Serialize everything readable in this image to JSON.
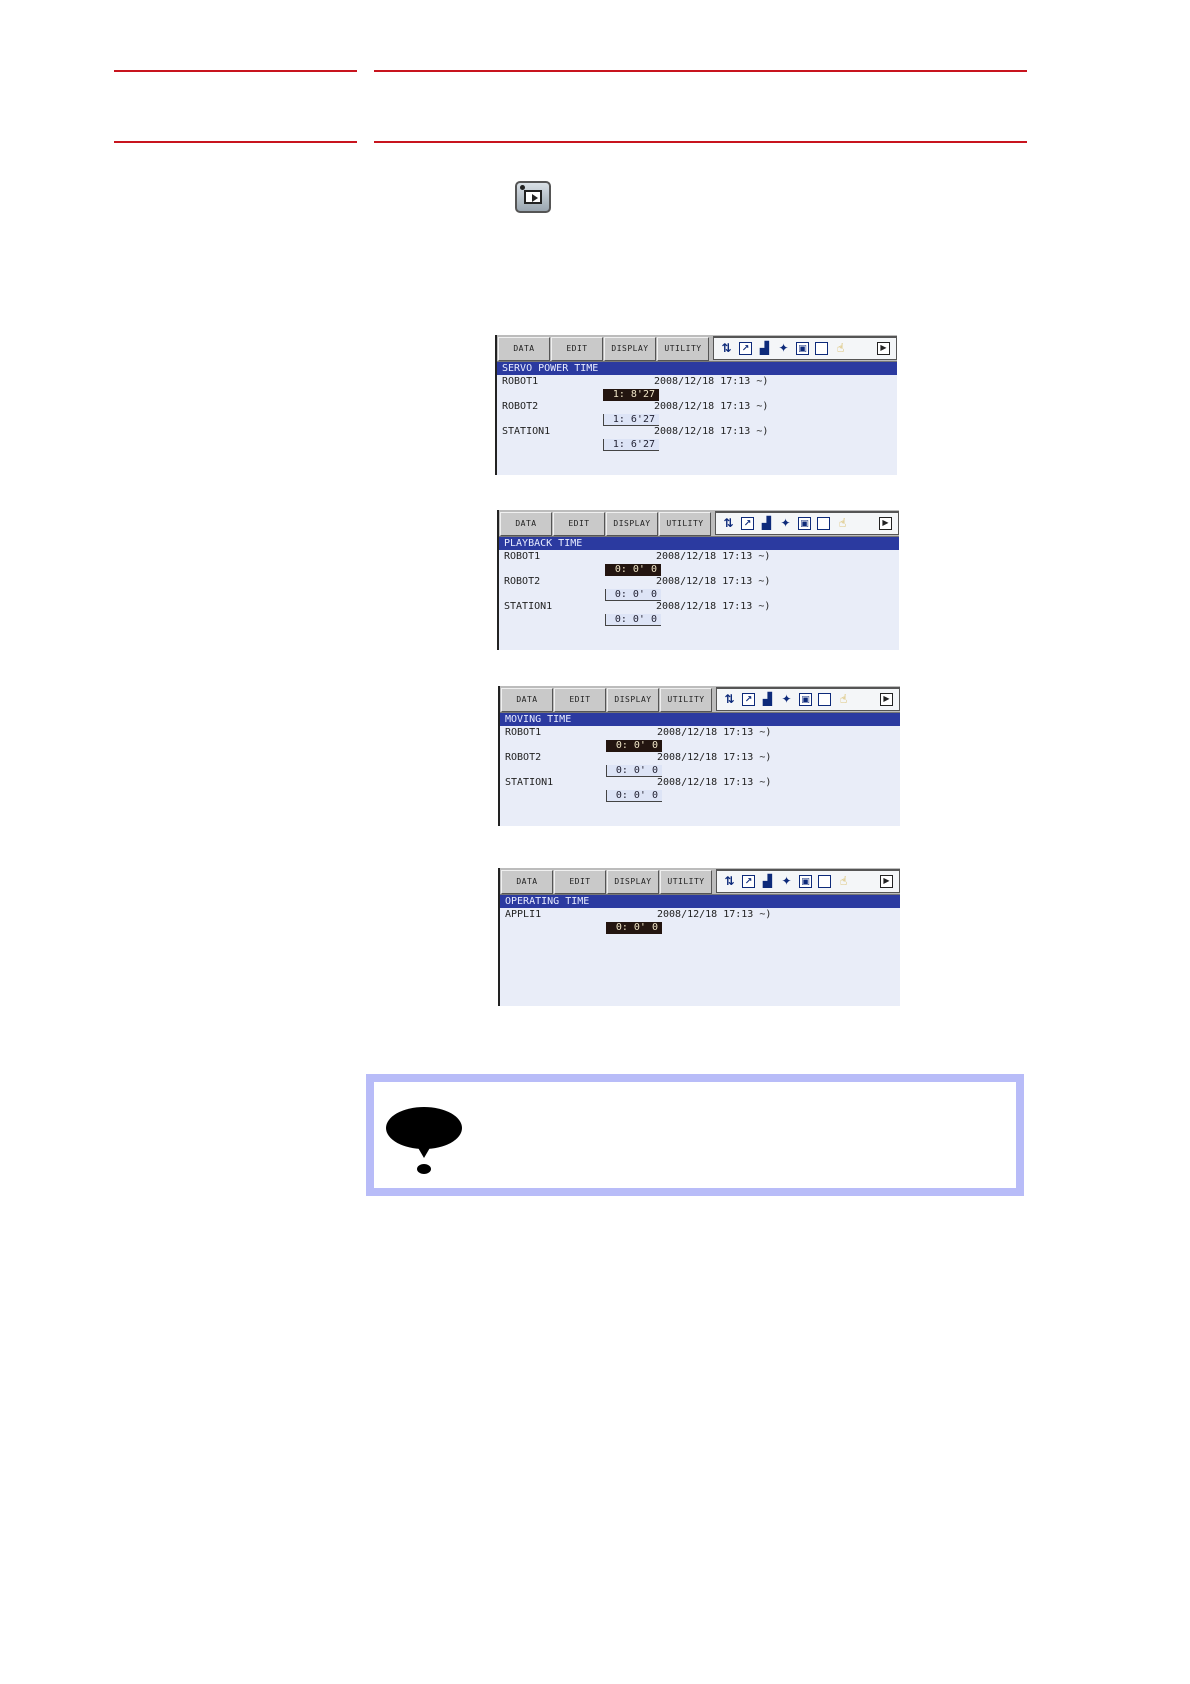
{
  "play_key_icon": "playback-mode-key-icon",
  "menu_labels": [
    "DATA",
    "EDIT",
    "DISPLAY",
    "UTILITY"
  ],
  "status_icons": [
    "coordinate-icon",
    "tool-icon",
    "signal-icon",
    "motion-icon",
    "security-icon",
    "page-icon",
    "hand-icon",
    "next-page-icon"
  ],
  "screens": [
    {
      "title": "SERVO POWER TIME",
      "rows": [
        {
          "label": "ROBOT1",
          "datetime": "2008/12/18 17:13 ~)",
          "value": "1: 8'27",
          "selected": true
        },
        {
          "label": "ROBOT2",
          "datetime": "2008/12/18 17:13 ~)",
          "value": "1: 6'27",
          "selected": false
        },
        {
          "label": "STATION1",
          "datetime": "2008/12/18 17:13 ~)",
          "value": "1: 6'27",
          "selected": false
        }
      ]
    },
    {
      "title": "PLAYBACK TIME",
      "rows": [
        {
          "label": "ROBOT1",
          "datetime": "2008/12/18 17:13 ~)",
          "value": "0: 0' 0",
          "selected": true
        },
        {
          "label": "ROBOT2",
          "datetime": "2008/12/18 17:13 ~)",
          "value": "0: 0' 0",
          "selected": false
        },
        {
          "label": "STATION1",
          "datetime": "2008/12/18 17:13 ~)",
          "value": "0: 0' 0",
          "selected": false
        }
      ]
    },
    {
      "title": "MOVING TIME",
      "rows": [
        {
          "label": "ROBOT1",
          "datetime": "2008/12/18 17:13 ~)",
          "value": "0: 0' 0",
          "selected": true
        },
        {
          "label": "ROBOT2",
          "datetime": "2008/12/18 17:13 ~)",
          "value": "0: 0' 0",
          "selected": false
        },
        {
          "label": "STATION1",
          "datetime": "2008/12/18 17:13 ~)",
          "value": "0: 0' 0",
          "selected": false
        }
      ]
    },
    {
      "title": "OPERATING TIME",
      "rows": [
        {
          "label": "APPLI1",
          "datetime": "2008/12/18 17:13 ~)",
          "value": "0: 0' 0",
          "selected": true
        }
      ]
    }
  ],
  "note_icon": "caution-icon",
  "colors": {
    "rule": "#c8141e",
    "titlebar": "#2b3aa0",
    "note_border": "#b8bcf8",
    "screen_bg": "#e9edf8"
  }
}
